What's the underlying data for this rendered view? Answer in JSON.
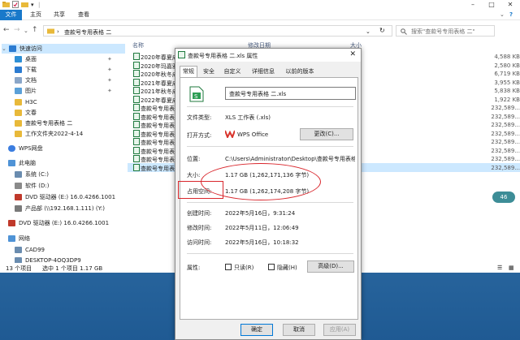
{
  "explorer": {
    "ribbon_tabs": [
      "文件",
      "主页",
      "共享",
      "查看"
    ],
    "breadcrumb": "查款号专用表格 二",
    "search_placeholder": "搜索\"查款号专用表格 二\"",
    "columns": {
      "name": "名称",
      "modified": "修改日期",
      "size": "大小"
    },
    "files": [
      {
        "name": "2020年春夏成",
        "size": "4,588 KB"
      },
      {
        "name": "2020年玛嘉雅",
        "size": "2,580 KB"
      },
      {
        "name": "2020年秋冬成",
        "size": "6,719 KB"
      },
      {
        "name": "2021年春夏成",
        "size": "3,955 KB"
      },
      {
        "name": "2021年秋冬成",
        "size": "5,838 KB"
      },
      {
        "name": "2022年春夏成",
        "size": "1,922 KB"
      },
      {
        "name": "查款号专用表",
        "size": "232,589..."
      },
      {
        "name": "查款号专用表",
        "size": "232,589..."
      },
      {
        "name": "查款号专用表",
        "size": "232,589..."
      },
      {
        "name": "查款号专用表",
        "size": "232,589..."
      },
      {
        "name": "查款号专用表",
        "size": "232,589..."
      },
      {
        "name": "查款号专用表",
        "size": "232,589..."
      },
      {
        "name": "查款号专用表",
        "size": "232,589..."
      },
      {
        "name": "查款号专用表",
        "size": "232,589..."
      }
    ],
    "sidebar": [
      {
        "label": "快速访问",
        "pinned": false
      },
      {
        "label": "桌面",
        "pinned": true
      },
      {
        "label": "下载",
        "pinned": true
      },
      {
        "label": "文档",
        "pinned": true
      },
      {
        "label": "图片",
        "pinned": true
      },
      {
        "label": "H3C",
        "pinned": false
      },
      {
        "label": "文春",
        "pinned": false
      },
      {
        "label": "查款号专用表格 二",
        "pinned": false
      },
      {
        "label": "工作文件夹2022-4-14",
        "pinned": false
      },
      {
        "label": "WPS网盘",
        "pinned": false
      },
      {
        "label": "此电脑",
        "pinned": false
      },
      {
        "label": "系统 (C:)",
        "pinned": false
      },
      {
        "label": "软件 (D:)",
        "pinned": false
      },
      {
        "label": "DVD 驱动器 (E:) 16.0.4266.1001",
        "pinned": false
      },
      {
        "label": "产品部 (\\\\192.168.1.111) (Y:)",
        "pinned": false
      },
      {
        "label": "DVD 驱动器 (E:) 16.0.4266.1001",
        "pinned": false
      },
      {
        "label": "网络",
        "pinned": false
      },
      {
        "label": "CAD99",
        "pinned": false
      },
      {
        "label": "DESKTOP-4OQ3DP9",
        "pinned": false
      }
    ],
    "status": {
      "count": "13 个项目",
      "selected": "选中 1 个项目  1.17 GB"
    },
    "badge": "46"
  },
  "dialog": {
    "title": "查款号专用表格 二.xls 属性",
    "tabs": [
      "常规",
      "安全",
      "自定义",
      "详细信息",
      "以前的版本"
    ],
    "filename": "查款号专用表格 二.xls",
    "rows": {
      "type_label": "文件类型:",
      "type_value": "XLS 工作表 (.xls)",
      "open_label": "打开方式:",
      "open_value": "WPS Office",
      "change_button": "更改(C)...",
      "location_label": "位置:",
      "location_value": "C:\\Users\\Administrator\\Desktop\\查款号专用表格 二",
      "size_label": "大小:",
      "size_value": "1.17 GB (1,262,171,136 字节)",
      "disk_label": "占用空间:",
      "disk_value": "1.17 GB (1,262,174,208 字节)",
      "created_label": "创建时间:",
      "created_value": "2022年5月16日，9:31:24",
      "modified_label": "修改时间:",
      "modified_value": "2022年5月11日，12:06:49",
      "accessed_label": "访问时间:",
      "accessed_value": "2022年5月16日，10:18:32",
      "attr_label": "属性:",
      "readonly_label": "只读(R)",
      "hidden_label": "隐藏(H)",
      "advanced_button": "高级(D)..."
    },
    "buttons": {
      "ok": "确定",
      "cancel": "取消",
      "apply": "应用(A)"
    },
    "annotation_color": "#d9262c",
    "wps_color": "#d8342c",
    "accent_color": "#1979ca"
  }
}
